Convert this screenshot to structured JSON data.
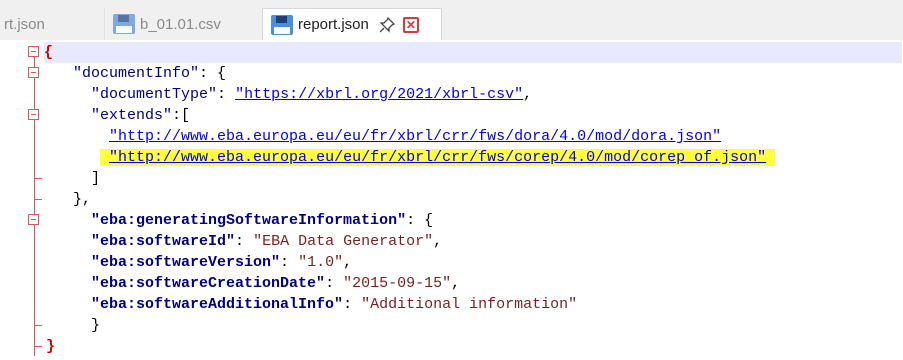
{
  "tabs": [
    {
      "label": "rt.json",
      "icon": "none",
      "active": false
    },
    {
      "label": "b_01.01.csv",
      "icon": "save-disk-icon",
      "active": false
    },
    {
      "label": "report.json",
      "icon": "save-disk-icon",
      "active": true,
      "pin": "pin-icon",
      "close": "close-icon"
    }
  ],
  "editor": {
    "highlight_color": "#ffff3a",
    "open_brace": "{",
    "close_brace": "}",
    "document_info": {
      "key": "\"documentInfo\"",
      "colon_brace": ": {",
      "document_type_key": "\"documentType\"",
      "document_type_value": "\"https://xbrl.org/2021/xbrl-csv\"",
      "extends_key": "\"extends\"",
      "extends_open": ":[",
      "extends": [
        "\"http://www.eba.europa.eu/eu/fr/xbrl/crr/fws/dora/4.0/mod/dora.json\"",
        "\"http://www.eba.europa.eu/eu/fr/xbrl/crr/fws/corep/4.0/mod/corep_of.json\""
      ],
      "extends_close": "]",
      "close": "},"
    },
    "software_info": {
      "key": "\"eba:generatingSoftwareInformation\"",
      "colon_brace": ": {",
      "entries": [
        {
          "key": "\"eba:softwareId\"",
          "value": "\"EBA Data Generator\"",
          "sep": ","
        },
        {
          "key": "\"eba:softwareVersion\"",
          "value": "\"1.0\"",
          "sep": ","
        },
        {
          "key": "\"eba:softwareCreationDate\"",
          "value": "\"2015-09-15\"",
          "sep": ","
        },
        {
          "key": "\"eba:softwareAdditionalInfo\"",
          "value": "\"Additional information\"",
          "sep": ""
        }
      ],
      "close": "}"
    }
  }
}
